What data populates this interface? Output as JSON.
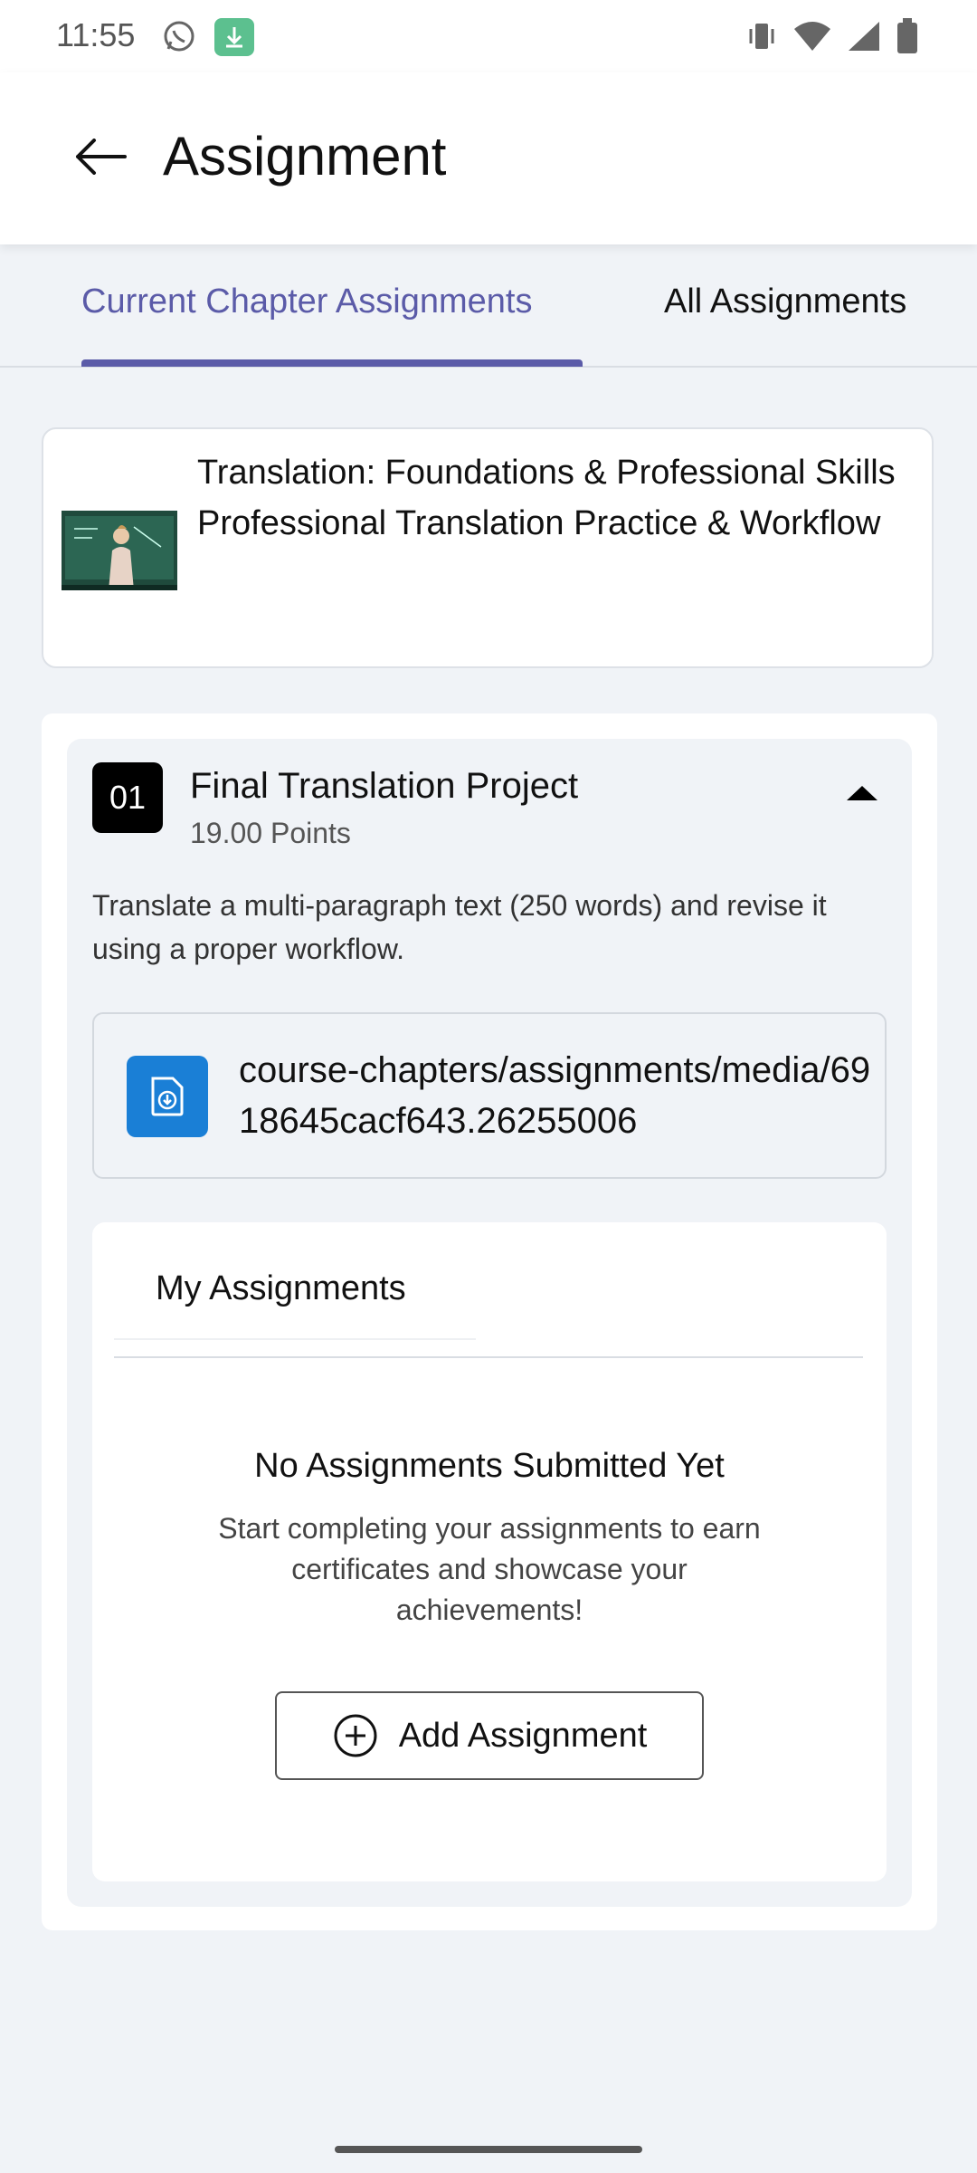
{
  "status_bar": {
    "time": "11:55",
    "icons": [
      "whatsapp-icon",
      "download-icon",
      "vibrate-icon",
      "wifi-icon",
      "signal-icon",
      "battery-icon"
    ]
  },
  "app_bar": {
    "title": "Assignment",
    "back_icon": "arrow-left-icon"
  },
  "tabs": [
    {
      "label": "Current Chapter Assignments",
      "active": true
    },
    {
      "label": "All Assignments",
      "active": false
    }
  ],
  "course": {
    "title": "Translation: Foundations & Professional Skills",
    "chapter": "Professional Translation Practice & Workflow"
  },
  "assignment": {
    "number": "01",
    "title": "Final Translation Project",
    "points": "19.00 Points",
    "description": "Translate a multi-paragraph text (250 words) and revise it using a proper workflow.",
    "file_path": "course-chapters/assignments/media/6918645cacf643.26255006"
  },
  "my_assignments": {
    "title": "My Assignments",
    "empty_title": "No Assignments Submitted Yet",
    "empty_subtitle": "Start completing your assignments to earn certificates and showcase your achievements!",
    "add_button": "Add Assignment"
  },
  "colors": {
    "accent": "#5b5ba8",
    "file_icon_bg": "#1a7fd6",
    "page_bg": "#f0f3f7"
  }
}
